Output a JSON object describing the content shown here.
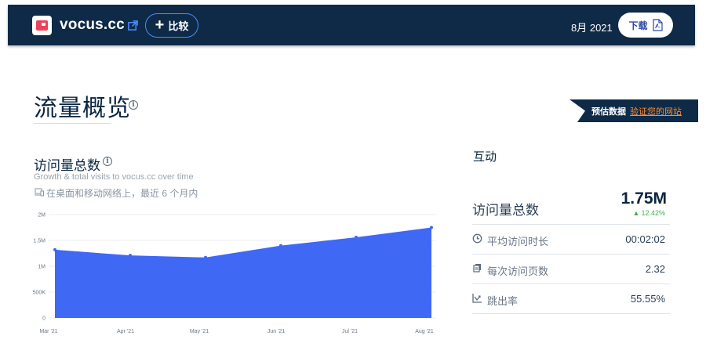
{
  "header": {
    "site_name": "vocus.cc",
    "compare_label": "比较",
    "date": "8月 2021",
    "download_label": "下载"
  },
  "page": {
    "title": "流量概览"
  },
  "estimate": {
    "label": "预估数据",
    "verify_link": "验证您的网站"
  },
  "visits": {
    "title": "访问量总数",
    "subtitle": "Growth & total visits to vocus.cc over time",
    "device_note": "在桌面和移动网络上，最近 6 个月内"
  },
  "engagement": {
    "title": "互动",
    "total_visits_label": "访问量总数",
    "total_visits_value": "1.75M",
    "total_visits_change": "12.42%",
    "rows": [
      {
        "label": "平均访问时长",
        "value": "00:02:02",
        "icon": "clock-icon"
      },
      {
        "label": "每次访问页数",
        "value": "2.32",
        "icon": "pages-icon"
      },
      {
        "label": "跳出率",
        "value": "55.55%",
        "icon": "bounce-icon"
      }
    ]
  },
  "colors": {
    "header_bg": "#0e2a47",
    "chart_fill": "#3f68f5",
    "accent_link": "#ff8c33",
    "positive": "#3fb24f"
  },
  "chart_data": {
    "type": "area",
    "x": [
      "Mar '21",
      "Apr '21",
      "May '21",
      "Jun '21",
      "Jul '21",
      "Aug '21"
    ],
    "values": [
      1320000,
      1210000,
      1170000,
      1400000,
      1560000,
      1750000
    ],
    "y_ticks": [
      "0",
      "500K",
      "1M",
      "1.5M",
      "2M"
    ],
    "ylim": [
      0,
      2000000
    ],
    "grid": true,
    "legend": "none"
  }
}
